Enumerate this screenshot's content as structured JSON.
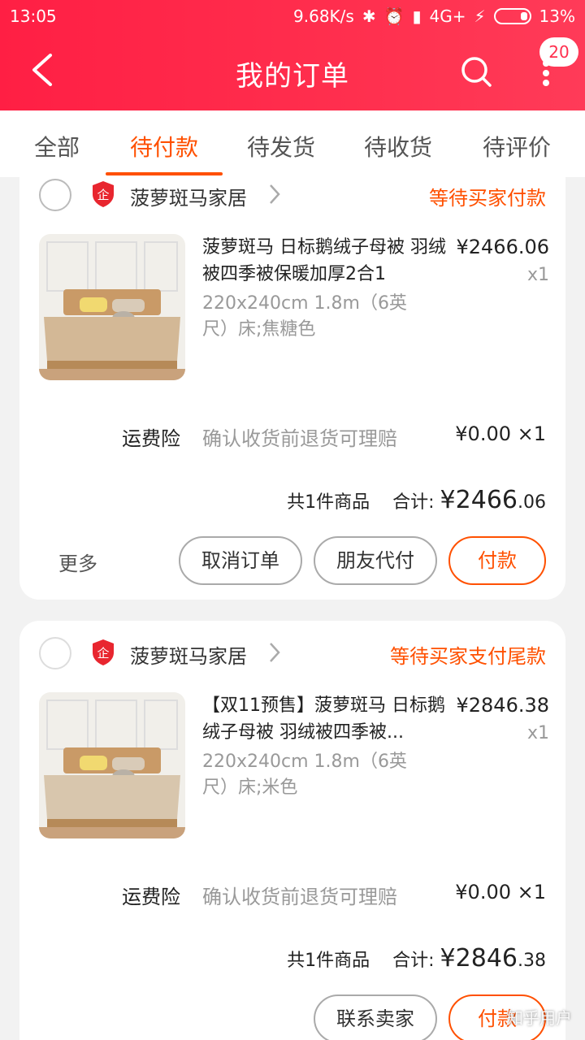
{
  "status_bar": {
    "time": "13:05",
    "speed": "9.68K/s",
    "network": "4G+",
    "battery": "13%"
  },
  "header": {
    "title": "我的订单",
    "badge_count": "20"
  },
  "tabs": [
    {
      "label": "全部"
    },
    {
      "label": "待付款"
    },
    {
      "label": "待发货"
    },
    {
      "label": "待收货"
    },
    {
      "label": "待评价"
    }
  ],
  "active_tab": "待付款",
  "orders": [
    {
      "shop_name": "菠萝斑马家居",
      "status": "等待买家付款",
      "product_title": "菠萝斑马 日标鹅绒子母被 羽绒被四季被保暖加厚2合1",
      "sku": "220x240cm 1.8m（6英尺）床;焦糖色",
      "price": "¥2466.06",
      "qty": "x1",
      "insurance_label": "运费险",
      "insurance_desc": "确认收货前退货可理赔",
      "insurance_price": "¥0.00 ×1",
      "summary_count": "共1件商品",
      "summary_label": "合计:",
      "total_currency": "¥",
      "total_int": "2466",
      "total_dec": ".06",
      "more": "更多",
      "buttons": [
        "取消订单",
        "朋友代付",
        "付款"
      ]
    },
    {
      "shop_name": "菠萝斑马家居",
      "status": "等待买家支付尾款",
      "product_title": "【双11预售】菠萝斑马 日标鹅绒子母被 羽绒被四季被...",
      "sku": "220x240cm 1.8m（6英尺）床;米色",
      "price": "¥2846.38",
      "qty": "x1",
      "insurance_label": "运费险",
      "insurance_desc": "确认收货前退货可理赔",
      "insurance_price": "¥0.00 ×1",
      "summary_count": "共1件商品",
      "summary_label": "合计:",
      "total_currency": "¥",
      "total_int": "2846",
      "total_dec": ".38",
      "buttons": [
        "联系卖家",
        "付款"
      ]
    }
  ],
  "watermark": "知乎用户",
  "colors": {
    "header_red": "#ff2f4e",
    "accent_orange": "#ff5000"
  }
}
